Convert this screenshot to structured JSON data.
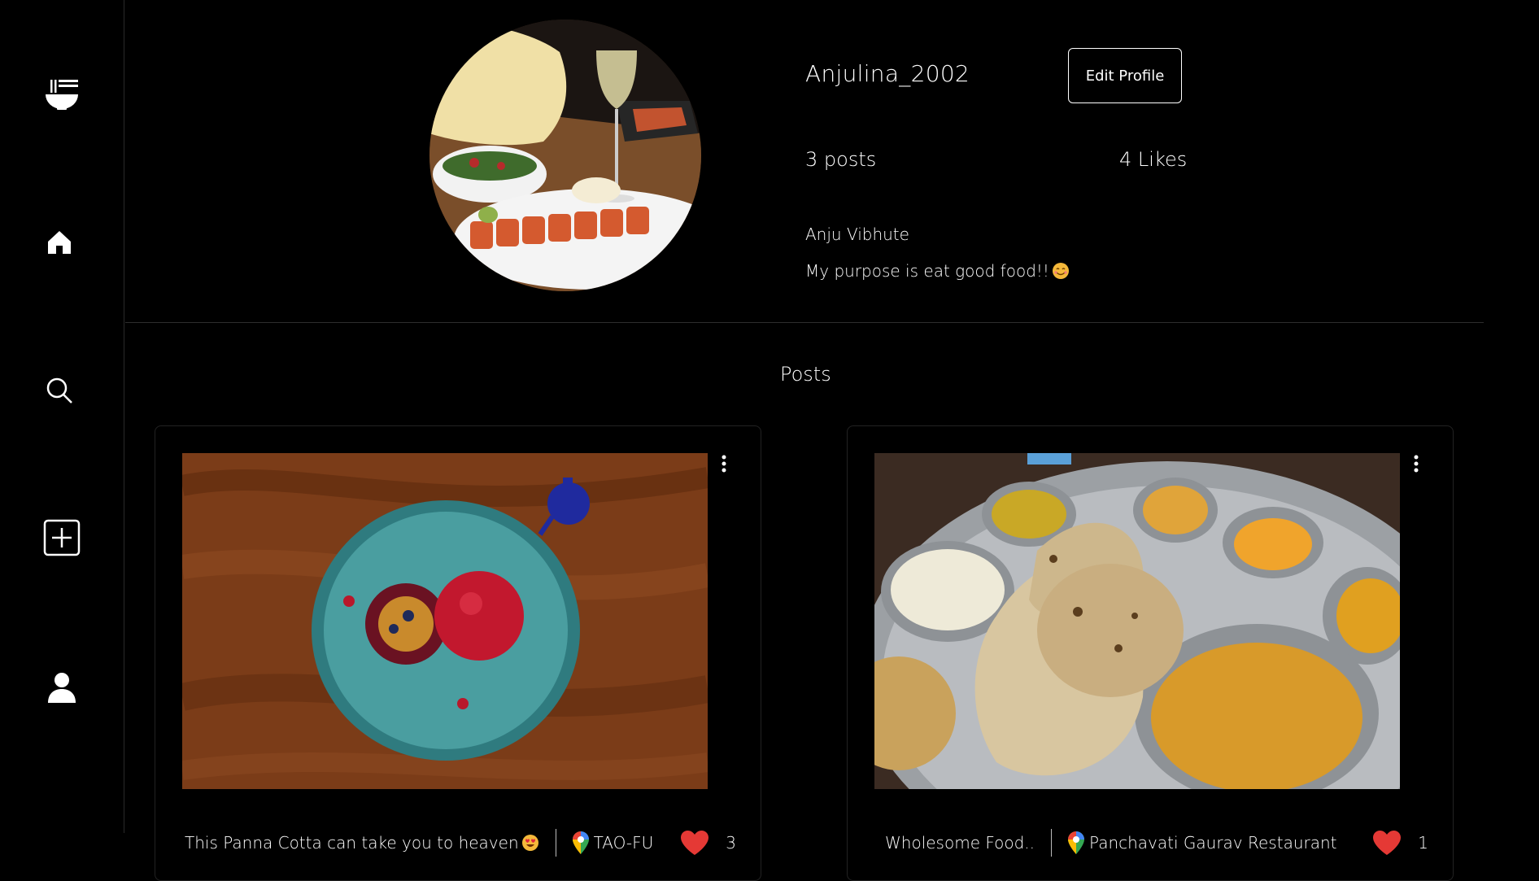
{
  "sidebar": {
    "items": [
      {
        "name": "logo",
        "icon": "bowl-icon"
      },
      {
        "name": "home",
        "icon": "home-icon"
      },
      {
        "name": "search",
        "icon": "search-icon"
      },
      {
        "name": "create",
        "icon": "plus-square-icon"
      },
      {
        "name": "profile",
        "icon": "user-icon"
      }
    ]
  },
  "profile": {
    "username": "Anjulina_2002",
    "edit_label": "Edit Profile",
    "posts_count": "3 posts",
    "likes_count": "4 Likes",
    "full_name": "Anju Vibhute",
    "bio": "My purpose is eat good food!!"
  },
  "posts_section": {
    "heading": "Posts"
  },
  "posts": [
    {
      "caption": "This Panna Cotta can take you to heaven",
      "location": "TAO-FU",
      "likes": "3"
    },
    {
      "caption": "Wholesome Food..",
      "location": "Panchavati Gaurav Restaurant",
      "likes": "1"
    }
  ],
  "colors": {
    "background": "#000000",
    "heart": "#e53935",
    "text": "#ffffff"
  }
}
